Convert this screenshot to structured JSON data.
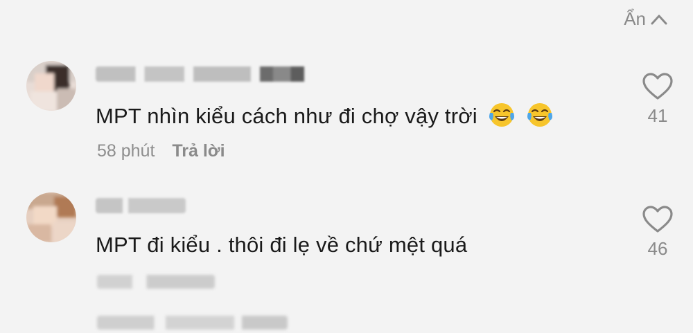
{
  "header": {
    "hide_label": "Ẩn"
  },
  "comments": [
    {
      "text": "MPT nhìn kiểu cách như đi chợ vậy trời",
      "emojis": [
        "tears-of-joy",
        "tears-of-joy"
      ],
      "time": "58 phút",
      "reply_label": "Trả lời",
      "likes": "41"
    },
    {
      "text": "MPT đi kiểu . thôi đi lẹ về chứ mệt quá",
      "likes": "46"
    }
  ]
}
